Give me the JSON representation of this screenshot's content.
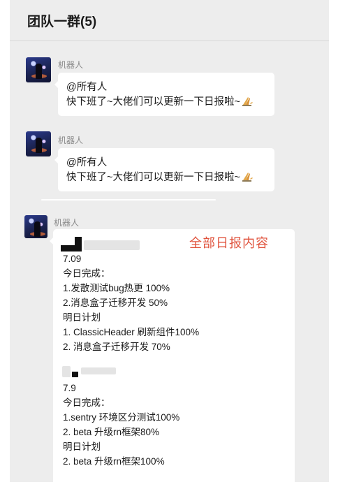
{
  "header": {
    "title": "团队一群(5)"
  },
  "messages": [
    {
      "sender": "机器人",
      "lines": [
        "@所有人",
        "快下班了~大佬们可以更新一下日报啦~"
      ],
      "emoji": "praying-hands-icon"
    },
    {
      "sender": "机器人",
      "lines": [
        "@所有人",
        "快下班了~大佬们可以更新一下日报啦~"
      ],
      "emoji": "praying-hands-icon"
    }
  ],
  "report": {
    "sender": "机器人",
    "overlay_label": "全部日报内容",
    "lines_a": [
      "7.09",
      "今日完成：",
      "1.发散测试bug热更 100%",
      "2.消息盒子迁移开发 50%",
      "明日计划",
      "1. ClassicHeader 刷新组件100%",
      "2. 消息盒子迁移开发 70%"
    ],
    "lines_b": [
      "7.9",
      "今日完成：",
      "1.sentry 环境区分测试100%",
      "2. beta 升级rn框架80%",
      "明日计划",
      "2. beta 升级rn框架100%"
    ]
  },
  "colors": {
    "background": "#ededed",
    "bubble": "#ffffff",
    "overlay_label": "#e0533d"
  }
}
